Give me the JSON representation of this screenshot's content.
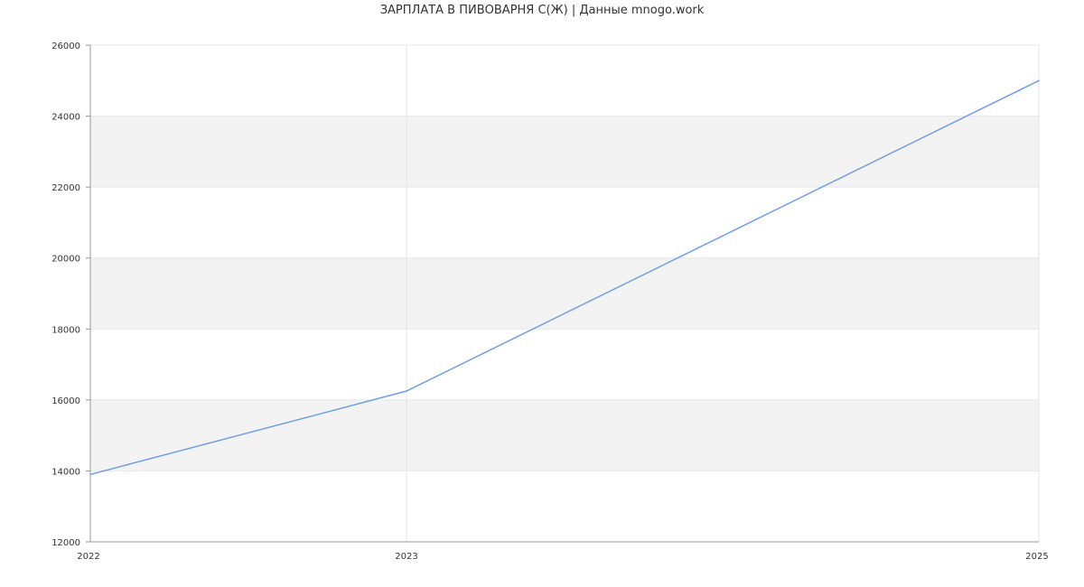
{
  "chart_data": {
    "type": "line",
    "title": "ЗАРПЛАТА В ПИВОВАРНЯ С(Ж) | Данные mnogo.work",
    "x": [
      "2022",
      "2023",
      "2025"
    ],
    "series": [
      {
        "values": [
          13900,
          16250,
          25000
        ]
      }
    ],
    "xlabel": "",
    "ylabel": "",
    "ylim": [
      12000,
      26000
    ],
    "yticks": [
      12000,
      14000,
      16000,
      18000,
      20000,
      22000,
      24000,
      26000
    ],
    "grid": true,
    "legend": "none"
  },
  "colors": {
    "line": "#6d9eeb",
    "band": "#f3f3f3",
    "grid": "#e6e6e6",
    "axis": "#999999"
  }
}
